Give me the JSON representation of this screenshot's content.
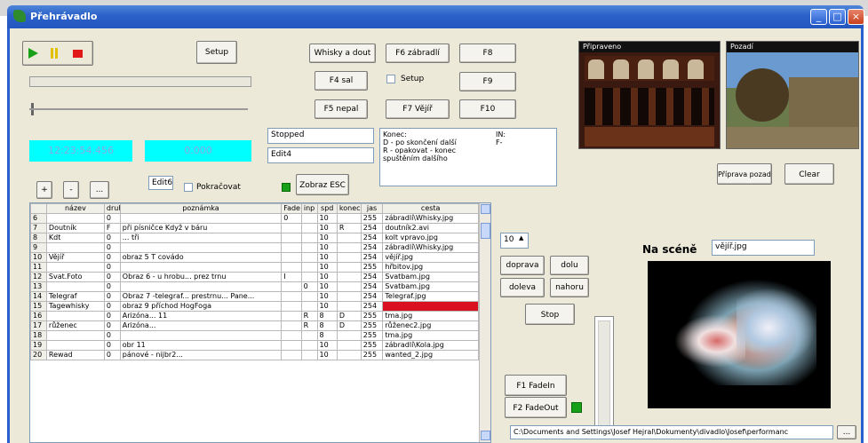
{
  "window": {
    "title": "Přehrávadlo"
  },
  "transport": {
    "play_icon": "play-icon",
    "pause_icon": "pause-icon",
    "stop_icon": "stop-icon"
  },
  "setup_button": "Setup",
  "time_display": {
    "position": "12:23:54.456",
    "counter": "0.000"
  },
  "nav": {
    "plus": "+",
    "minus": "-",
    "more": "..."
  },
  "edit6": "Edit6",
  "pokracovat_label": "Pokračovat",
  "show_esc_button": "Zobraz ESC",
  "status_field": "Stopped",
  "edit4": "Edit4",
  "cue_buttons": {
    "whisky": "Whisky a dout",
    "f6": "F6 zábradlí",
    "f8": "F8",
    "f4": "F4 sal",
    "setup_check": "Setup",
    "f9": "F9",
    "f5": "F5 nepal",
    "f7": "F7 Vějíř",
    "f10": "F10"
  },
  "info_text": {
    "line1_left": "Konec:",
    "line1_right": "IN:",
    "line2_left": "D - po skončení další",
    "line2_right": "F-",
    "line3": "R - opakovat - konec",
    "line4": "spuštěním dalšího"
  },
  "preview": {
    "prepared_label": "Připraveno",
    "background_label": "Pozadí"
  },
  "bg_buttons": {
    "prep_to_bg": "Příprava pozadí",
    "clear": "Clear"
  },
  "table": {
    "headers": [
      "",
      "název",
      "druh",
      "poznámka",
      "Fade",
      "inp",
      "spd",
      "konec",
      "jas",
      "cesta"
    ],
    "rows": [
      [
        "6",
        "",
        "0",
        "",
        "0",
        "",
        "10",
        "",
        "255",
        "zábradlí\\Whisky.jpg"
      ],
      [
        "7",
        "Doutník",
        "F",
        "při písničce Když v báru",
        "",
        "",
        "10",
        "R",
        "254",
        "doutník2.avi"
      ],
      [
        "8",
        "Kdt",
        "0",
        "... tři",
        "",
        "",
        "10",
        "",
        "254",
        "kolt vpravo.jpg"
      ],
      [
        "9",
        "",
        "0",
        "",
        "",
        "",
        "10",
        "",
        "254",
        "zábradlí\\Whisky.jpg"
      ],
      [
        "10",
        "Vějíř",
        "0",
        "obraz 5 T covádo",
        "",
        "",
        "10",
        "",
        "254",
        "vějíř.jpg"
      ],
      [
        "11",
        "",
        "0",
        "",
        "",
        "",
        "10",
        "",
        "255",
        "hřbitov.jpg"
      ],
      [
        "12",
        "Svat.Foto",
        "0",
        "Obraz 6 - u hrobu... prez trnu",
        "I",
        "",
        "10",
        "",
        "254",
        "Svatbam.jpg"
      ],
      [
        "13",
        "",
        "0",
        "",
        "",
        "0",
        "10",
        "",
        "254",
        "Svatbam.jpg"
      ],
      [
        "14",
        "Telegraf",
        "0",
        "Obraz 7 -telegraf... prestrnu... Pane...",
        "",
        "",
        "10",
        "",
        "254",
        "Telegraf.jpg"
      ],
      [
        "15",
        "Tagewhisky",
        "0",
        "obraz 9 příchod HogFoga",
        "",
        "",
        "10",
        "",
        "254",
        ""
      ],
      [
        "16",
        "",
        "0",
        "Arizóna... 11",
        "",
        "R",
        "8",
        "D",
        "255",
        "tma.jpg"
      ],
      [
        "17",
        "růženec",
        "0",
        "Arizóna...",
        "",
        "R",
        "8",
        "D",
        "255",
        "růženec2.jpg"
      ],
      [
        "18",
        "",
        "0",
        "",
        "",
        "",
        "8",
        "",
        "255",
        "tma.jpg"
      ],
      [
        "19",
        "",
        "0",
        "obr 11",
        "",
        "",
        "10",
        "",
        "255",
        "zábradlí\\Kola.jpg"
      ],
      [
        "20",
        "Rewad",
        "0",
        "pánové - nijbr2...",
        "",
        "",
        "10",
        "",
        "255",
        "wanted_2.jpg"
      ]
    ]
  },
  "spinner_value": "10",
  "move_buttons": {
    "right": "doprava",
    "down": "dolu",
    "left": "doleva",
    "up": "nahoru"
  },
  "stop_button": "Stop",
  "fade_buttons": {
    "in": "F1 FadeIn",
    "out": "F2 FadeOut"
  },
  "on_stage": {
    "label": "Na scéně",
    "file": "vějíř.jpg"
  },
  "path_field": "C:\\Documents and Settings\\Josef Hejral\\Dokumenty\\divadlo\\Josef\\performanc",
  "path_more": "...",
  "colors": {
    "accent_cyan": "#00ffff",
    "red_cell": "#d81020",
    "green_play": "#18a018"
  }
}
